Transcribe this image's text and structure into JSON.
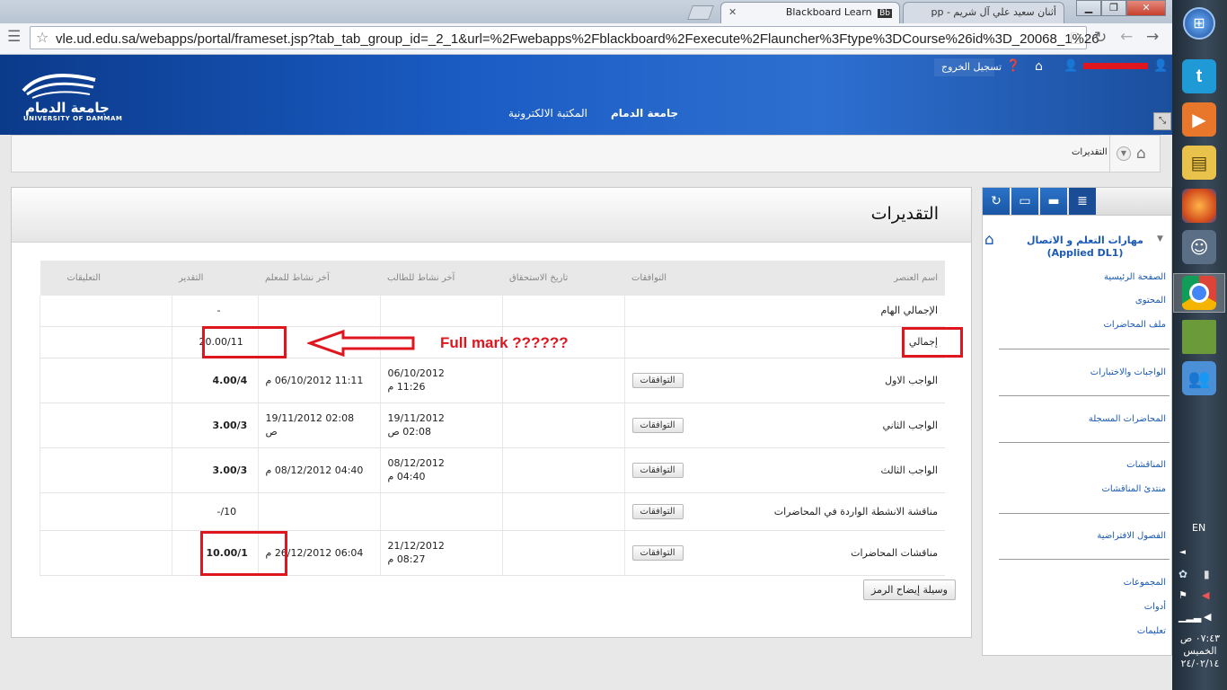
{
  "browser": {
    "tabs": [
      {
        "title": "Blackboard Learn",
        "badge": "Bb"
      },
      {
        "title": "أثنان سعيد علي آل شريم - pp"
      }
    ],
    "url": "vle.ud.edu.sa/webapps/portal/frameset.jsp?tab_tab_group_id=_2_1&url=%2Fwebapps%2Fblackboard%2Fexecute%2Flauncher%3Ftype%3DCourse%26id%3D_20068_1%26"
  },
  "header": {
    "logo_arabic": "جامعة الدمام",
    "logo_english": "UNIVERSITY OF DAMMAM",
    "logout": "تسجيل الخروج",
    "nav": [
      "جامعة الدمام",
      "المكتبة الالكترونية"
    ]
  },
  "breadcrumb": {
    "current": "التقديرات"
  },
  "page": {
    "title": "التقديرات",
    "columns": [
      "اسم العنصر",
      "التوافقات",
      "تاريخ الاستحقاق",
      "آخر نشاط للطالب",
      "آخر نشاط للمعلم",
      "التقدير",
      "التعليقات"
    ],
    "rows": [
      {
        "name": "الإجمالي الهام",
        "button": "",
        "due": "",
        "student": "",
        "teacher": "",
        "grade": "-"
      },
      {
        "name": "إجمالي",
        "button": "",
        "due": "",
        "student": "",
        "teacher": "",
        "grade": "20.00/11"
      },
      {
        "name": "الواجب الاول",
        "button": "التوافقات",
        "due": "",
        "student_date": "06/10/2012",
        "student_time": "11:26 م",
        "teacher": "11:11 06/10/2012 م",
        "grade": "4.00/4"
      },
      {
        "name": "الواجب الثاني",
        "button": "التوافقات",
        "due": "",
        "student_date": "19/11/2012",
        "student_time": "02:08 ص",
        "teacher_date": "02:08 19/11/2012",
        "teacher_time": "ص",
        "grade": "3.00/3"
      },
      {
        "name": "الواجب الثالث",
        "button": "التوافقات",
        "due": "",
        "student_date": "08/12/2012",
        "student_time": "04:40 م",
        "teacher": "04:40 08/12/2012 م",
        "grade": "3.00/3"
      },
      {
        "name": "مناقشة الانشطة الواردة في المحاضرات",
        "button": "التوافقات",
        "due": "",
        "student": "",
        "teacher": "",
        "grade": "-/10"
      },
      {
        "name": "مناقشات المحاضرات",
        "button": "التوافقات",
        "due": "",
        "student_date": "21/12/2012",
        "student_time": "08:27 م",
        "teacher": "06:04 26/12/2012 م",
        "grade": "10.00/1"
      }
    ],
    "legend_button": "وسيلة إيضاح الرمز"
  },
  "annotation": {
    "text": "Full mark ??????",
    "color": "#e0161f"
  },
  "course_menu": {
    "title": "مهارات التعلم و الاتصال (Applied DL1)",
    "groups": [
      [
        "الصفحة الرئيسية",
        "المحتوى",
        "ملف المحاضرات"
      ],
      [
        "الواجبات والاختبارات"
      ],
      [
        "المحاضرات المسجلة"
      ],
      [
        "المناقشات",
        "منتدئ المناقشات"
      ],
      [
        "الفصول الافتراضية"
      ],
      [
        "المجموعات",
        "أدوات",
        "تعليمات"
      ]
    ]
  },
  "taskbar": {
    "lang": "EN",
    "time": "٠٧:٤٣ ص",
    "day": "الخميس",
    "date": "٢٤/٠٢/١٤"
  }
}
